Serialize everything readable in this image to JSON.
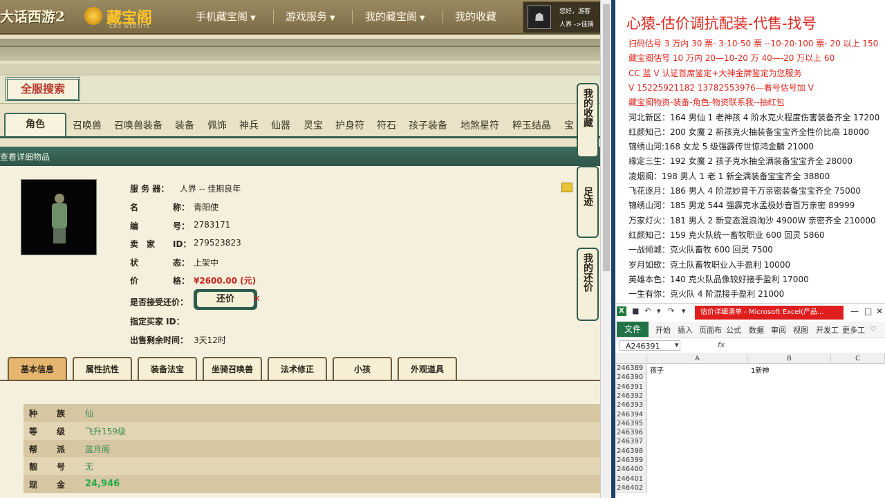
{
  "header": {
    "logo_main": "大话西游2",
    "logo_cbg": "藏宝阁",
    "logo_cbg_sub": "CBG WEBSITE",
    "nav": [
      {
        "label": "手机藏宝阁",
        "dropdown": true
      },
      {
        "label": "游戏服务",
        "dropdown": true
      },
      {
        "label": "我的藏宝阁",
        "dropdown": true
      },
      {
        "label": "我的收藏",
        "dropdown": false
      }
    ],
    "user_line1": "您好，游客",
    "user_line2": "人界 ->佳期"
  },
  "search_button": "全服搜索",
  "categories": [
    "角色",
    "召唤兽",
    "召唤兽装备",
    "装备",
    "佩饰",
    "神兵",
    "仙器",
    "灵宝",
    "护身符",
    "符石",
    "孩子装备",
    "地煞星符",
    "粹玉结晶",
    "宝"
  ],
  "detail_bar_title": "查看详细物品",
  "detail": {
    "server_label": "服 务 器：",
    "server_value": "人界 -- 佳期良年",
    "name_label_a": "名",
    "name_label_b": "称：",
    "name_value": "青阳使",
    "id_label_a": "编",
    "id_label_b": "号：",
    "id_value": "2783171",
    "seller_label_a": "卖",
    "seller_label_b": "家",
    "seller_label_c": "ID：",
    "seller_value": "279523823",
    "status_label_a": "状",
    "status_label_b": "态：",
    "status_value": "上架中",
    "price_label_a": "价",
    "price_label_b": "格：",
    "price_value": "¥2600.00 (元)",
    "bargain_label": "是否接受还价：",
    "bargain_button": "还价",
    "buyer_label": "指定买家 ID：",
    "remaining_label": "出售剩余时间：",
    "remaining_value": "3天12时"
  },
  "sub_tabs": [
    "基本信息",
    "属性抗性",
    "装备法宝",
    "坐骑召唤兽",
    "法术修正",
    "小孩",
    "外观道具"
  ],
  "basic_rows": [
    {
      "k1": "种",
      "k2": "族",
      "v": "仙"
    },
    {
      "k1": "等",
      "k2": "级",
      "v": "飞升159级"
    },
    {
      "k1": "帮",
      "k2": "派",
      "v": "蓝月阁"
    },
    {
      "k1": "靓",
      "k2": "号",
      "v": "无"
    },
    {
      "k1": "现",
      "k2": "金",
      "v": "24,946"
    }
  ],
  "side_tabs": [
    "我的收藏",
    "足迹",
    "我的还价"
  ],
  "right_panel": {
    "title": "心猿-估价调抗配装-代售-找号",
    "lines": [
      {
        "text": "扫码估号 3 万内 30 票- 3-10-50 票  --10-20-100 票- 20 以上 150",
        "color": "red"
      },
      {
        "text": "藏宝阁估号 10 万内 20—10-20 万 40—-20 万以上 60",
        "color": "red"
      },
      {
        "text": "CC 蓝 V 认证首席鉴定+大神金牌鉴定为您服务",
        "color": "red"
      },
      {
        "text": "V 15225921182     13782553976—看号估号加 V",
        "color": "red"
      },
      {
        "text": "藏宝阁物资-装备-角色-物资联系我--抽红包",
        "color": "red"
      },
      {
        "text": "河北新区：164 男仙 1 老神孩 4 阶水克火程度伤害装备齐全 17200",
        "color": "black"
      },
      {
        "text": "红颜知己：200 女魔 2 新孩克火抽装备宝宝齐全性价比高 18000",
        "color": "black"
      },
      {
        "text": "锦绣山河:168 女龙 5 级强霹传世惊鸿金麟 21000",
        "color": "black"
      },
      {
        "text": "缘定三生：192 女魔 2 孩子克水抽全满装备宝宝齐全 28000",
        "color": "black"
      },
      {
        "text": "凌烟阁：198 男人 1 老 1 新全满装备宝宝齐全 38800",
        "color": "black"
      },
      {
        "text": "飞花逐月：186 男人 4 阶混妙音千万亲密装备宝宝齐全 75000",
        "color": "black"
      },
      {
        "text": "锦绣山河：185 男龙 544 强霹克水孟极妙音百万亲密 89999",
        "color": "black"
      },
      {
        "text": "万家灯火：181 男人 2 新变态混浪淘沙 4900W 亲密齐全 210000",
        "color": "black"
      },
      {
        "text": "红颜知己：159 克火队统一畜牧职业 600 回灵 5860",
        "color": "black"
      },
      {
        "text": "一战倾城：克火队畜牧 600 回灵 7500",
        "color": "black"
      },
      {
        "text": "岁月如歌：克土队畜牧职业入手盈利 10000",
        "color": "black"
      },
      {
        "text": "英雄本色：140 克火队品像较好接手盈利 17000",
        "color": "black"
      },
      {
        "text": "一生有你：克火队 4 阶混接手盈利 21000",
        "color": "black"
      }
    ]
  },
  "excel": {
    "window_title": "估价详细清单 - Microsoft Excel(产品...",
    "ribbon_tabs": [
      "文件",
      "开始",
      "插入",
      "页面布",
      "公式",
      "数据",
      "审阅",
      "视图",
      "开发工",
      "更多工"
    ],
    "name_box": "A246391",
    "fx": "fx",
    "columns": [
      "A",
      "B",
      "C"
    ],
    "rows": [
      {
        "num": "246389",
        "a": "孩子",
        "b": "1新神"
      },
      {
        "num": "246390",
        "a": "",
        "b": ""
      },
      {
        "num": "246391",
        "a": "",
        "b": ""
      },
      {
        "num": "246392",
        "a": "",
        "b": ""
      },
      {
        "num": "246393",
        "a": "",
        "b": ""
      },
      {
        "num": "246394",
        "a": "",
        "b": ""
      },
      {
        "num": "246395",
        "a": "",
        "b": ""
      },
      {
        "num": "246396",
        "a": "",
        "b": ""
      },
      {
        "num": "246397",
        "a": "",
        "b": ""
      },
      {
        "num": "246398",
        "a": "",
        "b": ""
      },
      {
        "num": "246399",
        "a": "",
        "b": ""
      },
      {
        "num": "246400",
        "a": "",
        "b": ""
      },
      {
        "num": "246401",
        "a": "",
        "b": ""
      },
      {
        "num": "246402",
        "a": "",
        "b": ""
      }
    ]
  },
  "colors": {
    "accent_green": "#2f5b4d",
    "price_red": "#c8241a",
    "excel_green": "#217346"
  }
}
